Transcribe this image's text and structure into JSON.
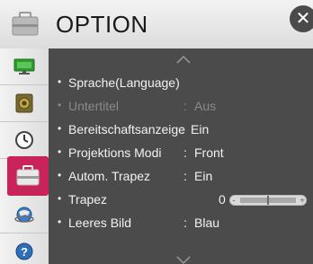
{
  "header": {
    "title": "OPTION"
  },
  "close": {
    "symbol": "✕"
  },
  "sidebar": {
    "items": [
      {
        "icon": "monitor-icon"
      },
      {
        "icon": "speaker-icon"
      },
      {
        "icon": "clock-icon"
      },
      {
        "icon": "toolbox-icon",
        "selected": true
      },
      {
        "icon": "globe-icon"
      },
      {
        "icon": "help-icon"
      }
    ]
  },
  "menu": {
    "items": [
      {
        "label": "Sprache(Language)",
        "value": "",
        "enabled": true
      },
      {
        "label": "Untertitel",
        "colon": ":",
        "value": "Aus",
        "enabled": false
      },
      {
        "label": "Bereitschaftsanzeige",
        "colon": ":",
        "value": "Ein",
        "enabled": true
      },
      {
        "label": "Projektions Modi",
        "colon": ":",
        "value": "Front",
        "enabled": true
      },
      {
        "label": "Autom. Trapez",
        "colon": ":",
        "value": "Ein",
        "enabled": true
      },
      {
        "label": "Trapez",
        "value": "0",
        "enabled": true,
        "slider_minus": "-",
        "slider_plus": "+"
      },
      {
        "label": "Leeres Bild",
        "colon": ":",
        "value": "Blau",
        "enabled": true
      }
    ]
  },
  "colors": {
    "accent": "#c8245a",
    "panel": "#4b4b4b",
    "header": "#e6e6e6"
  }
}
